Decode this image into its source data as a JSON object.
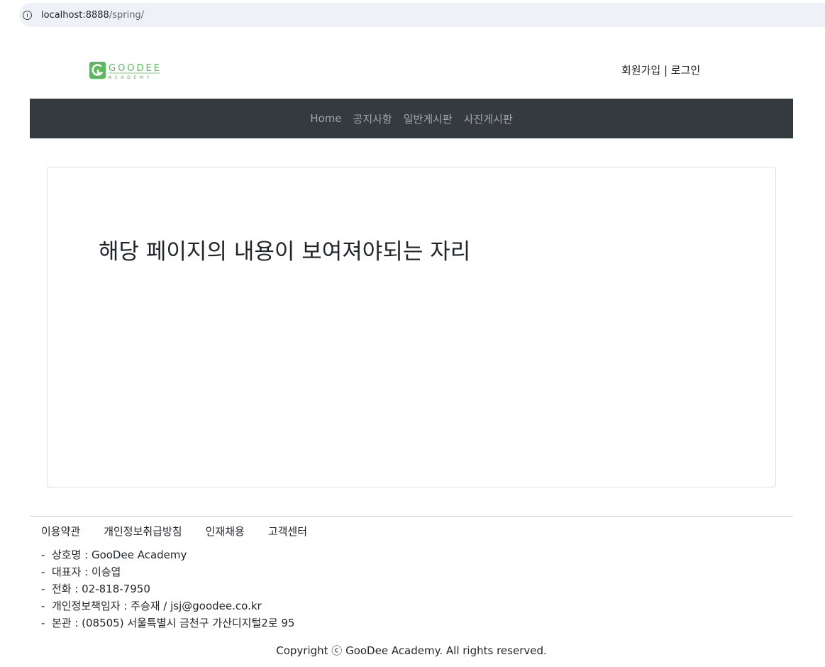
{
  "browser": {
    "url_host": "localhost:8888",
    "url_path": "/spring/"
  },
  "header": {
    "logo_text": "GOODEE",
    "logo_subtext": "ACADEMY",
    "auth_links": [
      "회원가입",
      "로그인"
    ],
    "auth_separator": " | "
  },
  "nav": {
    "items": [
      "Home",
      "공지사항",
      "일반게시판",
      "사진게시판"
    ]
  },
  "main": {
    "placeholder": "해당 페이지의 내용이 보여져야되는 자리"
  },
  "footer": {
    "links": [
      "이용약관",
      "개인정보취급방침",
      "인재채용",
      "고객센터"
    ],
    "info": [
      "상호명 : GooDee Academy",
      "대표자 : 이승엽",
      "전화 : 02-818-7950",
      "개인정보책임자 : 주승재 / jsj@goodee.co.kr",
      "본관 : (08505) 서울특별시 금천구 가산디지털2로 95"
    ],
    "copyright": "Copyright ⓒ GooDee Academy. All rights reserved."
  },
  "colors": {
    "navbar_bg": "#343a40",
    "logo_green": "#5cb85c",
    "address_bar_bg": "#eef1f8"
  }
}
